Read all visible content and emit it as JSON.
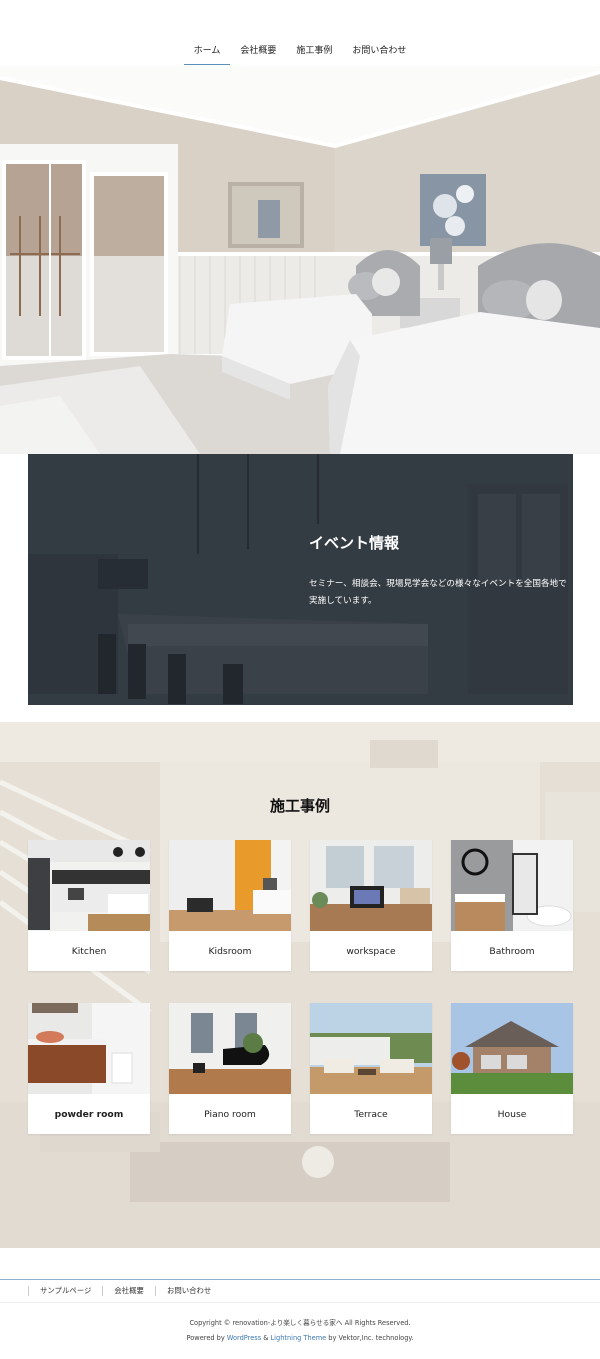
{
  "nav": {
    "items": [
      {
        "label": "ホーム"
      },
      {
        "label": "会社概要"
      },
      {
        "label": "施工事例"
      },
      {
        "label": "お問い合わせ"
      }
    ]
  },
  "event": {
    "title": "イベント情報",
    "text": "セミナー、相談会、現場見学会などの様々なイベントを全国各地で実施しています。"
  },
  "works": {
    "title": "施工事例",
    "cards": [
      {
        "label": "Kitchen"
      },
      {
        "label": "Kidsroom"
      },
      {
        "label": "workspace"
      },
      {
        "label": "Bathroom"
      },
      {
        "label": "powder room"
      },
      {
        "label": "Piano room"
      },
      {
        "label": "Terrace"
      },
      {
        "label": "House"
      }
    ]
  },
  "footer": {
    "links": [
      {
        "label": "サンプルページ"
      },
      {
        "label": "会社概要"
      },
      {
        "label": "お問い合わせ"
      }
    ],
    "copyright": "Copyright © renovation-より楽しく暮らせる家へ All Rights Reserved.",
    "powered_prefix": "Powered by ",
    "powered_wp": "WordPress",
    "powered_amp": " & ",
    "powered_theme": "Lightning Theme",
    "powered_suffix": " by Vektor,Inc. technology."
  },
  "colors": {
    "accent": "#5b8fb7",
    "link": "#3d7ab0",
    "event_overlay": "#1c242c"
  }
}
